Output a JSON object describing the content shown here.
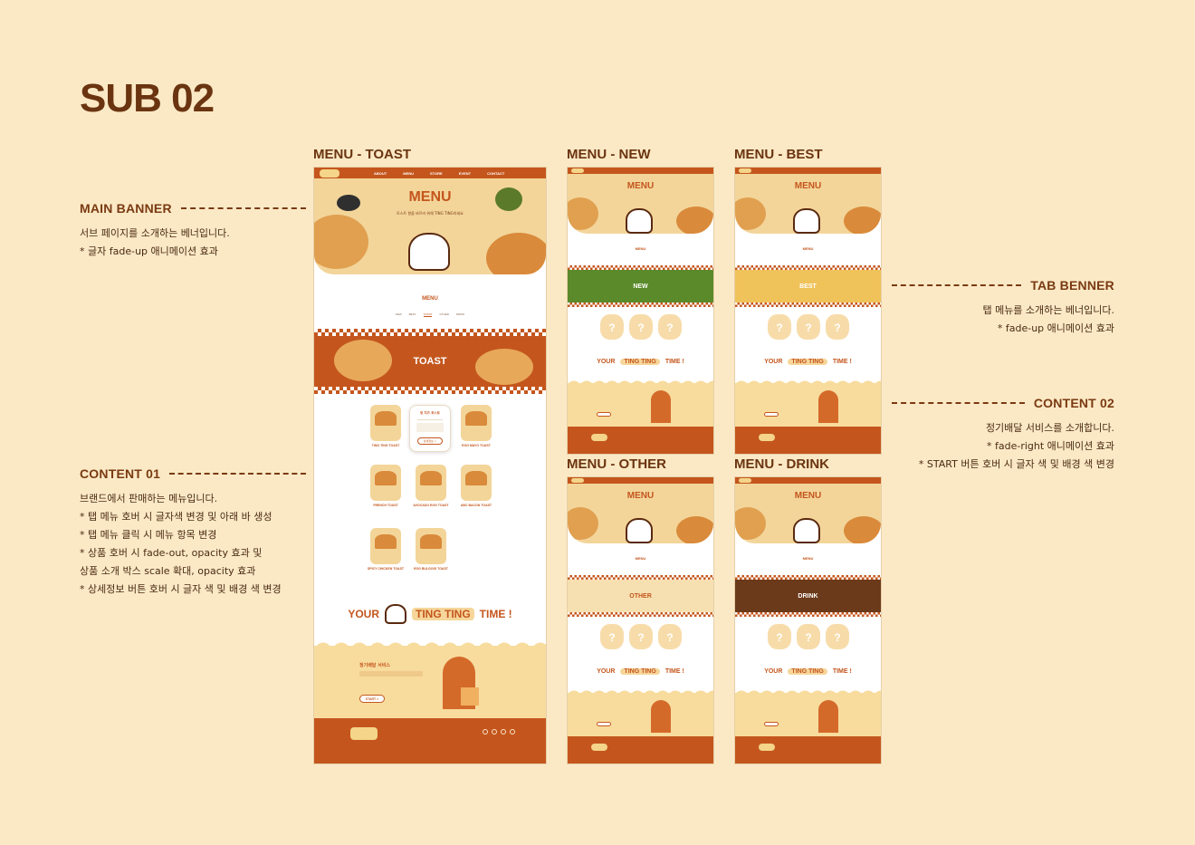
{
  "page": {
    "title": "SUB 02"
  },
  "annotations": {
    "main_banner": {
      "title": "MAIN BANNER",
      "lines": [
        "서브 페이지를 소개하는 베너입니다.",
        "* 글자 fade-up 애니메이션 효과"
      ]
    },
    "content_01": {
      "title": "CONTENT 01",
      "lines": [
        "브랜드에서 판매하는 메뉴입니다.",
        "* 탭 메뉴 호버 시 글자색 변경 및 아래 바 생성",
        "* 탭 메뉴 클릭 시 메뉴 항목 변경",
        "* 상품 호버 시 fade-out, opacity 효과 및",
        "상품 소개 박스 scale 확대, opacity 효과",
        "* 상세정보 버튼 호버 시 글자 색 및 배경 색 변경"
      ]
    },
    "tab_banner": {
      "title": "TAB BENNER",
      "lines": [
        "탭 메뉴를 소개하는 베너입니다.",
        "* fade-up 애니메이션 효과"
      ]
    },
    "content_02": {
      "title": "CONTENT 02",
      "lines": [
        "정기배달 서비스를 소개합니다.",
        "* fade-right 애니메이션 효과",
        "* START 버튼 호버 시 글자 색 및 배경 색 변경"
      ]
    }
  },
  "screens": {
    "toast": {
      "label": "MENU - TOAST",
      "banner": "TOAST"
    },
    "new": {
      "label": "MENU - NEW",
      "banner": "NEW"
    },
    "best": {
      "label": "MENU - BEST",
      "banner": "BEST"
    },
    "other": {
      "label": "MENU - OTHER",
      "banner": "OTHER"
    },
    "drink": {
      "label": "MENU - DRINK",
      "banner": "DRINK"
    }
  },
  "mockup": {
    "nav_items": [
      "ABOUT",
      "MENU",
      "STORE",
      "EVENT",
      "CONTACT"
    ],
    "hero_title": "MENU",
    "hero_sub": "토스트 향을 바르러 위해 TING TING하세요",
    "section_title": "MENU",
    "tabs": [
      "NEW",
      "BEST",
      "TOAST",
      "OTHER",
      "DRINK"
    ],
    "products": [
      "TING TING TOAST",
      "EGG MAYO TOAST",
      "FRENCH TOAST",
      "AVOCADO EGG TOAST",
      "ABC BACON TOAST",
      "SPICY CHICKEN TOAST",
      "EGG BULGOGI TOAST"
    ],
    "info_card": {
      "title": "팅 치즈 토스트",
      "button": "상세정보 >"
    },
    "slogan": {
      "your": "YOUR",
      "ting": "TING TING",
      "time": "TIME !"
    },
    "delivery_title": "정기배달 서비스",
    "start_button": "START >",
    "question_mark": "?"
  },
  "colors": {
    "background": "#fbe9c6",
    "brand_orange": "#c4561d",
    "brown_text": "#6b3410",
    "cream": "#f3d59a"
  }
}
